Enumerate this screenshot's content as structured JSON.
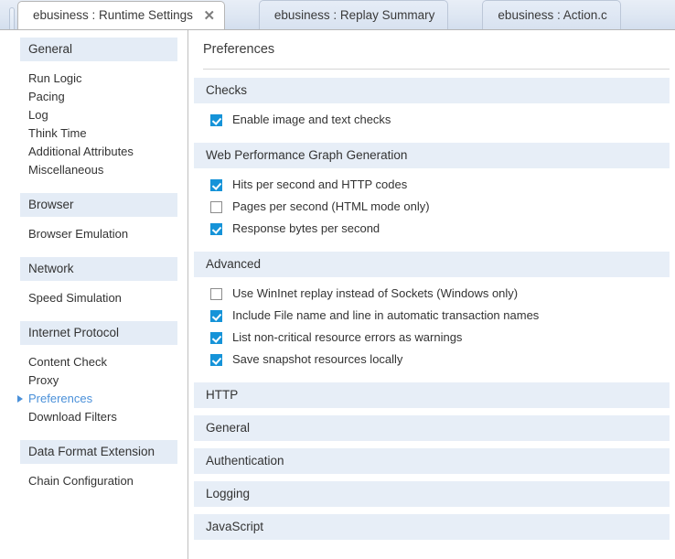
{
  "tabs": [
    {
      "label": "ebusiness : Runtime Settings",
      "active": true,
      "close_icon": "✕"
    },
    {
      "label": "ebusiness : Replay Summary",
      "active": false
    },
    {
      "label": "ebusiness : Action.c",
      "active": false
    }
  ],
  "sidebar": {
    "groups": [
      {
        "header": "General",
        "items": [
          {
            "label": "Run Logic",
            "selected": false
          },
          {
            "label": "Pacing",
            "selected": false
          },
          {
            "label": "Log",
            "selected": false
          },
          {
            "label": "Think Time",
            "selected": false
          },
          {
            "label": "Additional Attributes",
            "selected": false
          },
          {
            "label": "Miscellaneous",
            "selected": false
          }
        ]
      },
      {
        "header": "Browser",
        "items": [
          {
            "label": "Browser Emulation",
            "selected": false
          }
        ]
      },
      {
        "header": "Network",
        "items": [
          {
            "label": "Speed Simulation",
            "selected": false
          }
        ]
      },
      {
        "header": "Internet Protocol",
        "items": [
          {
            "label": "Content Check",
            "selected": false
          },
          {
            "label": "Proxy",
            "selected": false
          },
          {
            "label": "Preferences",
            "selected": true
          },
          {
            "label": "Download Filters",
            "selected": false
          }
        ]
      },
      {
        "header": "Data Format Extension",
        "items": [
          {
            "label": "Chain Configuration",
            "selected": false
          }
        ]
      }
    ]
  },
  "main": {
    "title": "Preferences",
    "sections": [
      {
        "header": "Checks",
        "options": [
          {
            "label": "Enable image and text checks",
            "checked": true
          }
        ]
      },
      {
        "header": "Web Performance Graph Generation",
        "options": [
          {
            "label": "Hits per second and HTTP codes",
            "checked": true
          },
          {
            "label": "Pages per second (HTML mode only)",
            "checked": false
          },
          {
            "label": "Response bytes per second",
            "checked": true
          }
        ]
      },
      {
        "header": "Advanced",
        "options": [
          {
            "label": "Use WinInet replay instead of Sockets (Windows only)",
            "checked": false
          },
          {
            "label": "Include File name and line in automatic transaction names",
            "checked": true
          },
          {
            "label": "List non-critical resource errors as warnings",
            "checked": true
          },
          {
            "label": "Save snapshot resources locally",
            "checked": true
          }
        ]
      },
      {
        "header": "HTTP",
        "options": []
      },
      {
        "header": "General",
        "options": []
      },
      {
        "header": "Authentication",
        "options": []
      },
      {
        "header": "Logging",
        "options": []
      },
      {
        "header": "JavaScript",
        "options": []
      }
    ]
  },
  "colors": {
    "accent": "#1593d8",
    "selected_text": "#4a90d9",
    "section_header_bg": "#e7eef7",
    "sidebar_header_bg": "#e4ecf6",
    "tab_active_bg": "#ffffff"
  }
}
